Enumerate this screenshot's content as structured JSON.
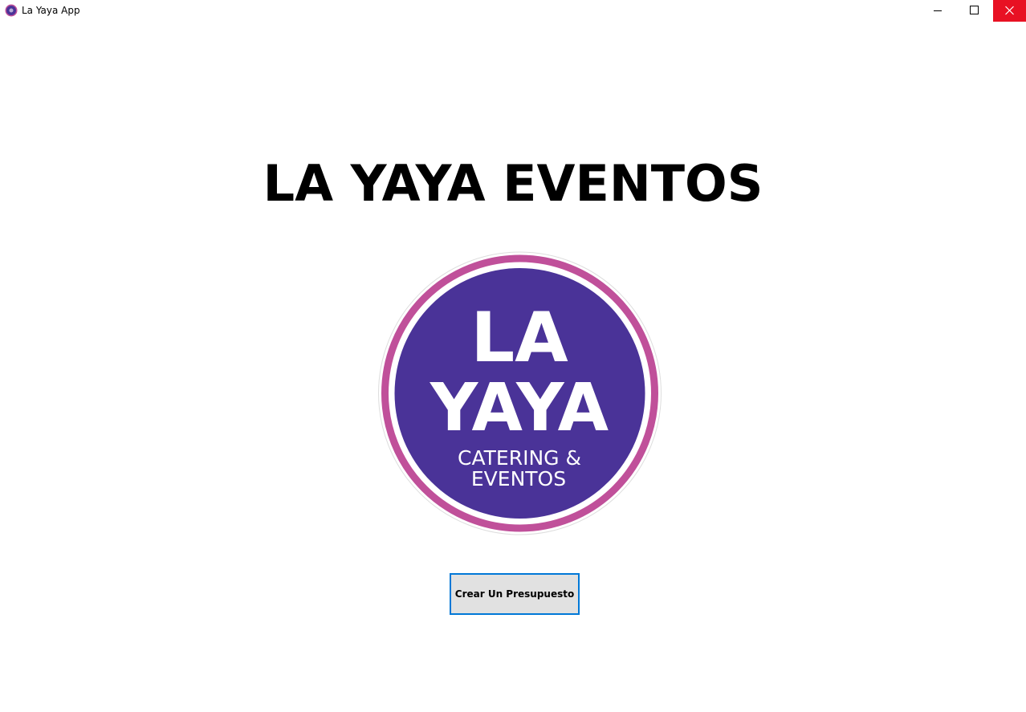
{
  "window": {
    "title": "La Yaya App",
    "icon": "la-yaya-app-icon",
    "close_color": "#e81123"
  },
  "main": {
    "heading": "LA YAYA EVENTOS",
    "logo": {
      "line1": "LA",
      "line2": "YAYA",
      "line3": "CATERING &",
      "line4": "EVENTOS",
      "circle_color": "#4a3398",
      "ring_color": "#c0509a"
    },
    "button_label": "Crear Un Presupuesto"
  }
}
